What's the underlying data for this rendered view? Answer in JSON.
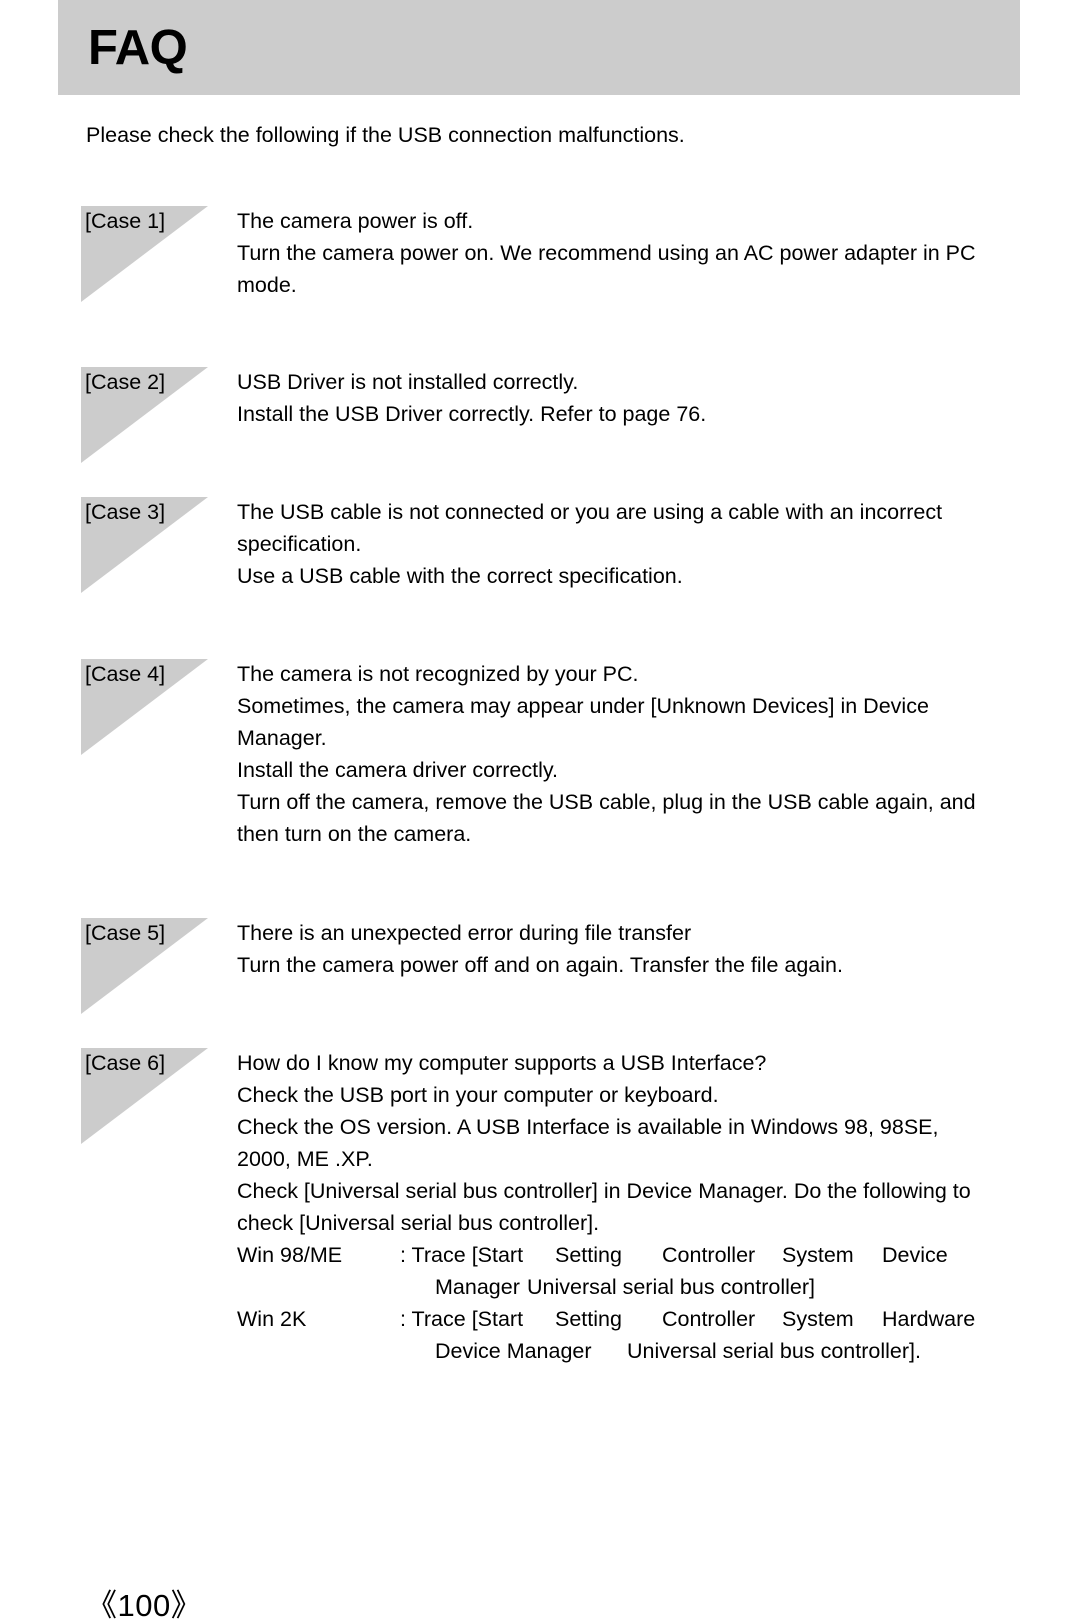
{
  "header": {
    "title": "FAQ",
    "bar_color": "#cccccc"
  },
  "intro": "Please check the following if the USB connection malfunctions.",
  "cases": [
    {
      "label": "[Case 1]",
      "lines": [
        "The camera power is off.",
        "Turn the camera power on. We recommend using an AC power adapter in PC",
        "mode."
      ]
    },
    {
      "label": "[Case 2]",
      "lines": [
        "USB Driver is not installed correctly.",
        "Install the USB Driver correctly. Refer to page 76."
      ]
    },
    {
      "label": "[Case 3]",
      "lines": [
        "The USB cable is not connected or you are using a cable with an incorrect",
        "specification.",
        "Use a USB cable with the correct specification."
      ]
    },
    {
      "label": "[Case 4]",
      "lines": [
        "The camera is not recognized by your PC.",
        "Sometimes, the camera may appear under [Unknown Devices] in Device",
        "Manager.",
        "Install the camera driver correctly.",
        "Turn off the camera, remove the USB cable, plug in the USB cable again, and",
        "then turn on the camera."
      ]
    },
    {
      "label": "[Case 5]",
      "lines": [
        "There is an unexpected error during file transfer",
        "Turn the camera power off and on again. Transfer the file again."
      ]
    },
    {
      "label": "[Case 6]",
      "lines": [
        "How do I know my computer supports a USB Interface?",
        "Check the USB port in your computer or keyboard.",
        "Check the OS version. A USB Interface is available in Windows 98, 98SE,",
        "2000, ME .XP.",
        "Check [Universal serial bus controller] in Device Manager. Do the following to",
        "check [Universal serial bus controller]."
      ],
      "os_rows": [
        {
          "label": "Win 98/ME",
          "trace": ": Trace [Start",
          "columns": [
            "Setting",
            "Controller",
            "System",
            "Device"
          ],
          "continuation_a": "Manager",
          "continuation_b": "Universal serial bus controller]"
        },
        {
          "label": "Win 2K",
          "trace": ": Trace [Start",
          "columns": [
            "Setting",
            "Controller",
            "System",
            "Hardware"
          ],
          "continuation_a": "Device Manager",
          "continuation_b": "Universal serial bus controller]."
        }
      ]
    }
  ],
  "footer": {
    "page_number": "《100》"
  }
}
